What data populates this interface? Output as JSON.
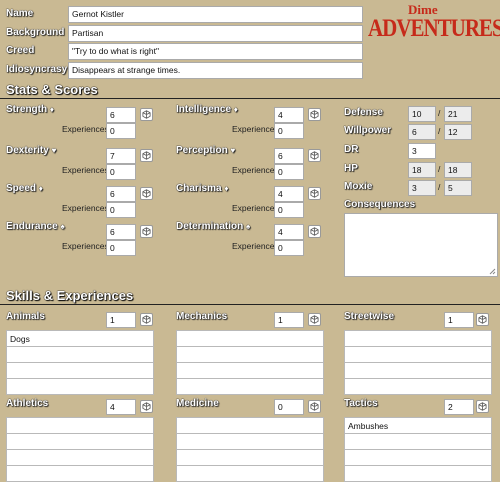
{
  "identity": [
    {
      "label": "Name",
      "value": "Gernot Kistler"
    },
    {
      "label": "Background",
      "value": "Partisan"
    },
    {
      "label": "Creed",
      "value": "\"Try to do what is right\""
    },
    {
      "label": "Idiosyncrasy",
      "value": "Disappears at strange times."
    }
  ],
  "logo": {
    "line1": "Dime",
    "line2": "ADVENTURES",
    "color": "#c62a1a"
  },
  "stats_heading": "Stats & Scores",
  "exp_label": "Experiences",
  "stats": [
    {
      "name": "Strength",
      "suit": "♦",
      "value": "6",
      "exp": "0"
    },
    {
      "name": "Dexterity",
      "suit": "♥",
      "value": "7",
      "exp": "0"
    },
    {
      "name": "Speed",
      "suit": "♦",
      "value": "6",
      "exp": "0"
    },
    {
      "name": "Endurance",
      "suit": "♠",
      "value": "6",
      "exp": "0"
    },
    {
      "name": "Intelligence",
      "suit": "♦",
      "value": "4",
      "exp": "0"
    },
    {
      "name": "Perception",
      "suit": "♥",
      "value": "6",
      "exp": "0"
    },
    {
      "name": "Charisma",
      "suit": "♦",
      "value": "4",
      "exp": "0"
    },
    {
      "name": "Determination",
      "suit": "♠",
      "value": "4",
      "exp": "0"
    }
  ],
  "scores": [
    {
      "label": "Defense",
      "value": "10",
      "max": "21"
    },
    {
      "label": "Willpower",
      "value": "6",
      "max": "12"
    },
    {
      "label": "DR",
      "value": "3"
    },
    {
      "label": "HP",
      "value": "18",
      "max": "18"
    },
    {
      "label": "Moxie",
      "value": "3",
      "max": "5"
    }
  ],
  "slash": "/",
  "consequences_label": "Consequences",
  "skills_heading": "Skills & Experiences",
  "skills": [
    {
      "name": "Animals",
      "value": "1",
      "entries": [
        "Dogs",
        "",
        "",
        ""
      ]
    },
    {
      "name": "Mechanics",
      "value": "1",
      "entries": [
        "",
        "",
        "",
        ""
      ]
    },
    {
      "name": "Streetwise",
      "value": "1",
      "entries": [
        "",
        "",
        "",
        ""
      ]
    },
    {
      "name": "Athletics",
      "value": "4",
      "entries": [
        "",
        "",
        "",
        ""
      ]
    },
    {
      "name": "Medicine",
      "value": "0",
      "entries": [
        "",
        "",
        "",
        ""
      ]
    },
    {
      "name": "Tactics",
      "value": "2",
      "entries": [
        "Ambushes",
        "",
        "",
        ""
      ]
    }
  ]
}
